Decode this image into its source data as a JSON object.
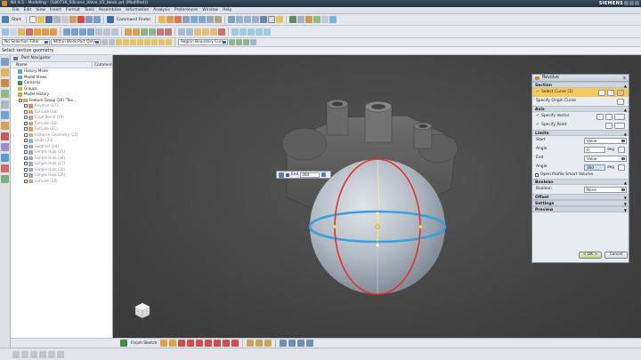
{
  "window": {
    "title": "NX 8.5 - Modeling - [180718_Silicone_Valve_V2_block.prt (Modified)]",
    "brand": "SIEMENS"
  },
  "menu": [
    "File",
    "Edit",
    "View",
    "Insert",
    "Format",
    "Tools",
    "Assemblies",
    "Information",
    "Analysis",
    "Preferences",
    "Window",
    "Help"
  ],
  "toolbar": {
    "start_label": "Start",
    "command_finder": "Command Finder"
  },
  "selection_bar": {
    "filter": "No Selection Filter",
    "scope": "Within Work Part Only",
    "curve_rule": "Region Boundary Curv"
  },
  "cue_line": "Select section geometry",
  "part_navigator": {
    "title": "Part Navigator",
    "col_name": "Name",
    "col_comment": "Comment",
    "nodes": [
      {
        "label": "History Mode",
        "indent": 1,
        "state": "on",
        "icon": "#6a9fd4"
      },
      {
        "label": "Model Views",
        "indent": 1,
        "state": "on",
        "icon": "#6a9fd4"
      },
      {
        "label": "Cameras",
        "indent": 1,
        "state": "on",
        "icon": "#3f8d3f"
      },
      {
        "label": "Groups",
        "indent": 1,
        "state": "on",
        "icon": "#d6a84a"
      },
      {
        "label": "Model History",
        "indent": 1,
        "state": "on",
        "icon": "#d6a84a"
      },
      {
        "label": "Feature Group (16) \"Tes...",
        "indent": 2,
        "state": "on",
        "icon": "#d6a84a"
      },
      {
        "label": "Revolve (17)",
        "indent": 3,
        "state": "dim",
        "icon": "#d88a7a"
      },
      {
        "label": "Extrude (18)",
        "indent": 3,
        "state": "dim",
        "icon": "#d8a070"
      },
      {
        "label": "Edge Blend (19)",
        "indent": 3,
        "state": "dim",
        "icon": "#9aa8c0"
      },
      {
        "label": "Extrude (20)",
        "indent": 3,
        "state": "dim",
        "icon": "#d8a070"
      },
      {
        "label": "Extrude (21)",
        "indent": 3,
        "state": "dim",
        "icon": "#d8a070"
      },
      {
        "label": "Instance Geometry (22)",
        "indent": 3,
        "state": "dim",
        "icon": "#c7b37a"
      },
      {
        "label": "Unite (23)",
        "indent": 3,
        "state": "dim",
        "icon": "#8fb0d0"
      },
      {
        "label": "Subtract (24)",
        "indent": 3,
        "state": "dim",
        "icon": "#8fb0d0"
      },
      {
        "label": "Simple Hole (25)",
        "indent": 3,
        "state": "dim",
        "icon": "#a0a8b0"
      },
      {
        "label": "Simple Hole (26)",
        "indent": 3,
        "state": "dim",
        "icon": "#a0a8b0"
      },
      {
        "label": "Simple Hole (27)",
        "indent": 3,
        "state": "dim",
        "icon": "#a0a8b0"
      },
      {
        "label": "Simple Hole (28)",
        "indent": 3,
        "state": "dim",
        "icon": "#a0a8b0"
      },
      {
        "label": "Simple Hole (29)",
        "indent": 3,
        "state": "dim",
        "icon": "#a0a8b0"
      },
      {
        "label": "Extrude (30)",
        "indent": 3,
        "state": "dim",
        "icon": "#d8a070"
      }
    ]
  },
  "onscreen_input": {
    "label": "End",
    "value": "360"
  },
  "revolve_dialog": {
    "title": "Revolve",
    "groups": {
      "section": "Section",
      "axis": "Axis",
      "limits": "Limits",
      "boolean": "Boolean",
      "offset": "Offset",
      "settings": "Settings",
      "preview": "Preview"
    },
    "select_curve": "Select Curve (1)",
    "specify_origin_curve": "Specify Origin Curve",
    "specify_vector": "Specify Vector",
    "specify_point": "Specify Point",
    "start_label": "Start",
    "start_type": "Value",
    "start_angle_label": "Angle",
    "start_angle": "0",
    "end_label": "End",
    "end_type": "Value",
    "end_angle_label": "Angle",
    "end_angle": "360",
    "unit": "deg",
    "open_profile": "Open Profile Smart Volume",
    "boolean_label": "Boolean",
    "boolean_value": "None",
    "ok": "< OK >",
    "cancel": "Cancel"
  },
  "sketch_toolbar": {
    "label": "Finish Sketch"
  },
  "colors": {
    "highlight": "#f4c85a",
    "viewport": "#474747",
    "section_curve": "#e53030",
    "preview_ring": "#3aa0e0"
  }
}
